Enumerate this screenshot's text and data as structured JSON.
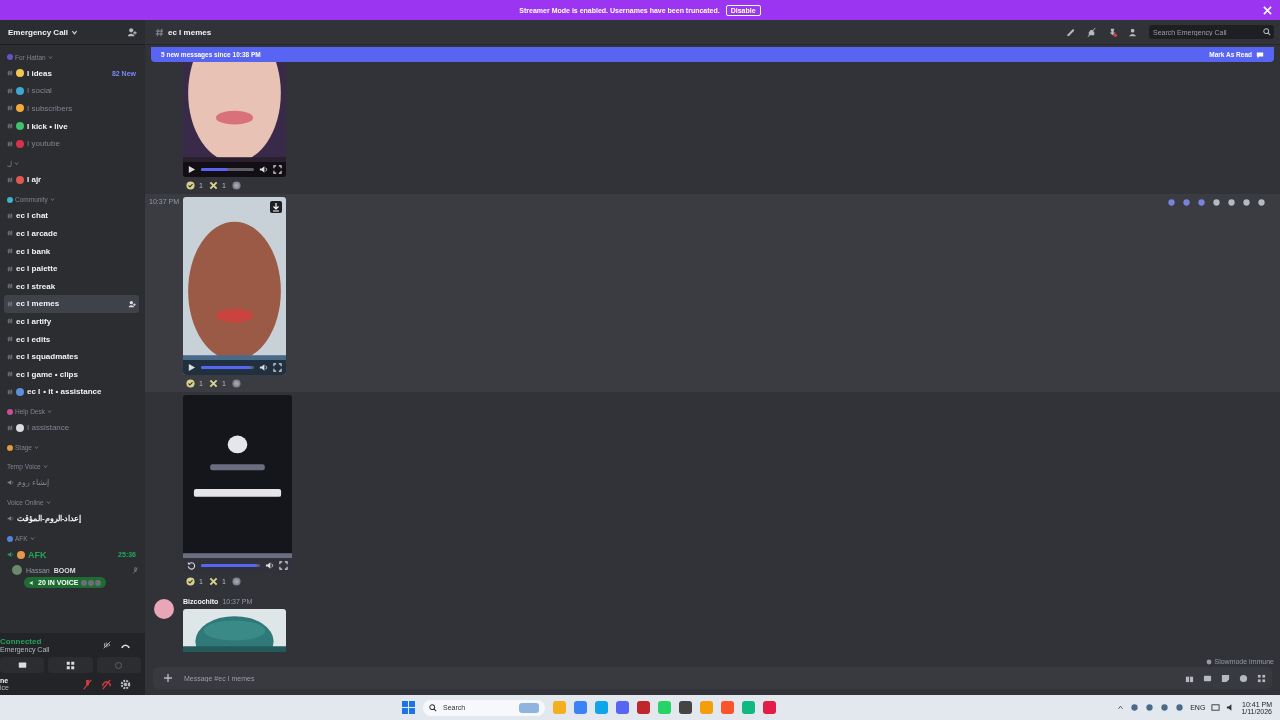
{
  "banner": {
    "text": "Streamer Mode is enabled. Usernames have been truncated.",
    "button": "Disable"
  },
  "server": {
    "name": "Emergency Call"
  },
  "channels": [
    {
      "kind": "category",
      "name": "For Hattan",
      "color": "#6a4fc8"
    },
    {
      "kind": "text",
      "name": "I ideas",
      "unread": true,
      "selected": false,
      "color": "#f2c94c",
      "badge": "82 New"
    },
    {
      "kind": "text",
      "name": "I social",
      "unread": false,
      "selected": false,
      "color": "#3fa7d6"
    },
    {
      "kind": "text",
      "name": "I subscribers",
      "unread": false,
      "selected": false,
      "color": "#f2a93b"
    },
    {
      "kind": "text",
      "name": "I kick • live",
      "unread": true,
      "selected": false,
      "color": "#3fc26b"
    },
    {
      "kind": "text",
      "name": "I youtube",
      "unread": false,
      "selected": false,
      "color": "#d8314b"
    },
    {
      "kind": "category",
      "name": "ل"
    },
    {
      "kind": "text",
      "name": "I ajr",
      "unread": true,
      "selected": false,
      "color": "#e0584f"
    },
    {
      "kind": "category",
      "name": "Community",
      "color": "#3fb3c9"
    },
    {
      "kind": "text",
      "name": "ec I chat",
      "unread": true,
      "selected": false
    },
    {
      "kind": "text",
      "name": "ec I arcade",
      "unread": true,
      "selected": false
    },
    {
      "kind": "text",
      "name": "ec I bank",
      "unread": true,
      "selected": false
    },
    {
      "kind": "text",
      "name": "ec I palette",
      "unread": true,
      "selected": false
    },
    {
      "kind": "text",
      "name": "ec I streak",
      "unread": true,
      "selected": false
    },
    {
      "kind": "text",
      "name": "ec I memes",
      "unread": true,
      "selected": true
    },
    {
      "kind": "text",
      "name": "ec I artify",
      "unread": true,
      "selected": false
    },
    {
      "kind": "text",
      "name": "ec I edits",
      "unread": true,
      "selected": false
    },
    {
      "kind": "text",
      "name": "ec I squadmates",
      "unread": true,
      "selected": false
    },
    {
      "kind": "text",
      "name": "ec I game • clips",
      "unread": true,
      "selected": false
    },
    {
      "kind": "text",
      "name": "ec I",
      "suffix": "• it • assistance",
      "unread": true,
      "selected": false,
      "color": "#5b8fd9"
    },
    {
      "kind": "category",
      "name": "Help Desk",
      "color": "#c94f9a"
    },
    {
      "kind": "text",
      "name": "I assistance",
      "unread": false,
      "selected": false,
      "color": "#d9dbe0"
    },
    {
      "kind": "category",
      "name": "Stage",
      "color": "#e39a3b"
    },
    {
      "kind": "category",
      "name": "Temp Voice"
    },
    {
      "kind": "voice",
      "name": "إنشاء روم",
      "unread": false,
      "selected": false
    },
    {
      "kind": "category",
      "name": "Voice Online"
    },
    {
      "kind": "voice",
      "name": "إعداد-الروم-المؤقت",
      "unread": true,
      "selected": false
    },
    {
      "kind": "category",
      "name": "AFK",
      "color": "#4f86d9"
    },
    {
      "kind": "voice",
      "name": "AFK",
      "unread": true,
      "selected": false,
      "color": "#e8964a",
      "active": true,
      "timer": "25:36"
    }
  ],
  "voice_user": {
    "name": "Hassan",
    "tag": "BOOM",
    "badge": "20 IN VOICE"
  },
  "connection": {
    "status": "Connected",
    "server": "Emergency Call"
  },
  "user_panel": {
    "name": "ne",
    "status": "ice"
  },
  "header": {
    "channel": "ec I memes",
    "search_placeholder": "Search Emergency Call"
  },
  "new_messages": {
    "text": "5 new messages since 10:38 PM",
    "action": "Mark As Read"
  },
  "messages": [
    {
      "kind": "video",
      "player": {
        "kind": "play",
        "level": 0.5
      },
      "reactions": [
        {
          "kind": "check",
          "count": "1"
        },
        {
          "kind": "cross",
          "count": "1"
        }
      ]
    },
    {
      "kind": "video",
      "time": "10:37 PM",
      "player": {
        "kind": "play",
        "level": 0.95
      },
      "download": true,
      "highlighted": true,
      "reactions": [
        {
          "kind": "check",
          "count": "1"
        },
        {
          "kind": "cross",
          "count": "1"
        }
      ]
    },
    {
      "kind": "video",
      "player": {
        "kind": "replay",
        "level": 0.95
      },
      "download": false,
      "highlighted": false,
      "reactions": [
        {
          "kind": "check",
          "count": "1"
        },
        {
          "kind": "cross",
          "count": "1"
        }
      ]
    },
    {
      "kind": "post",
      "author": "Bizcochito",
      "time": "10:37 PM"
    }
  ],
  "slowmode": "Slowmode immune",
  "composer": {
    "placeholder": "Message #ec I memes"
  },
  "taskbar": {
    "search": "Search",
    "language": "ENG",
    "time": "10:41 PM",
    "date": "1/11/2026"
  }
}
